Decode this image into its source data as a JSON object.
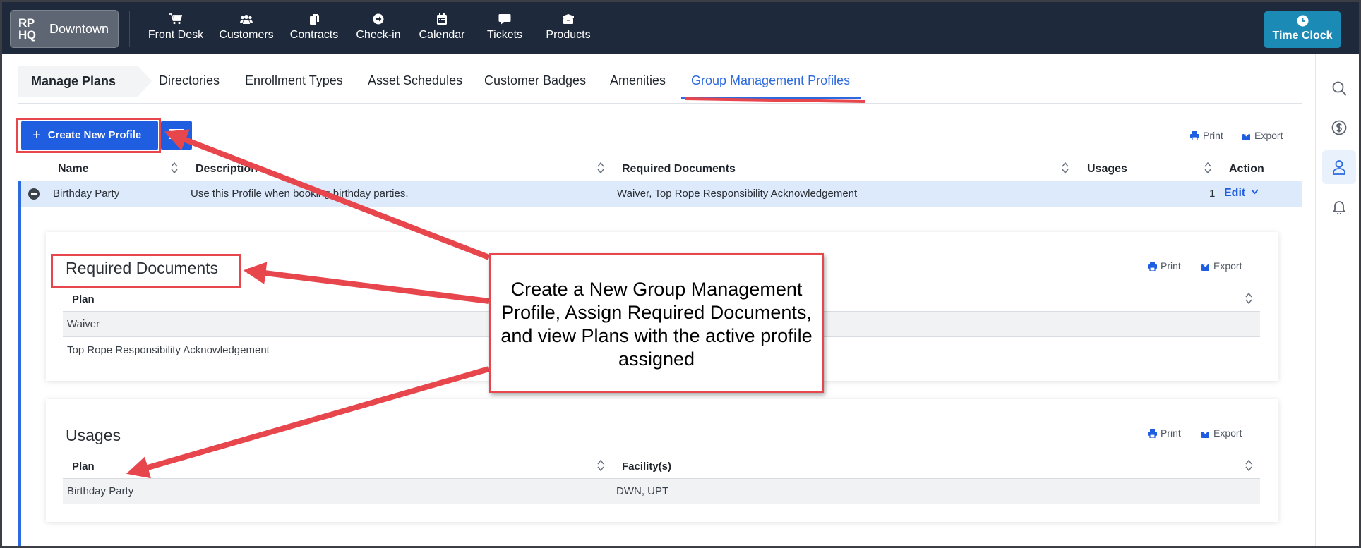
{
  "topbar": {
    "logo_mark_line1": "RP",
    "logo_mark_line2": "HQ",
    "location": "Downtown",
    "nav": [
      {
        "label": "Front Desk",
        "icon": "cart-icon"
      },
      {
        "label": "Customers",
        "icon": "users-icon"
      },
      {
        "label": "Contracts",
        "icon": "documents-icon"
      },
      {
        "label": "Check-in",
        "icon": "arrow-circle-icon"
      },
      {
        "label": "Calendar",
        "icon": "calendar-icon"
      },
      {
        "label": "Tickets",
        "icon": "chat-icon"
      },
      {
        "label": "Products",
        "icon": "box-icon"
      }
    ],
    "time_clock_label": "Time Clock"
  },
  "right_rail": [
    "search-icon",
    "dollar-icon",
    "user-icon",
    "bell-icon"
  ],
  "subtabs": {
    "section": "Manage Plans",
    "tabs": [
      "Directories",
      "Enrollment Types",
      "Asset Schedules",
      "Customer Badges",
      "Amenities",
      "Group Management Profiles"
    ],
    "active_tab": "Group Management Profiles"
  },
  "toolbar": {
    "create_label": "Create New Profile",
    "print_label": "Print",
    "export_label": "Export"
  },
  "table": {
    "headers": [
      "Name",
      "Description",
      "Required Documents",
      "Usages",
      "Action"
    ],
    "row": {
      "name": "Birthday Party",
      "description": "Use this Profile when booking birthday parties.",
      "required_documents": "Waiver, Top Rope Responsibility Acknowledgement",
      "usages": "1",
      "action": "Edit"
    }
  },
  "required_documents_panel": {
    "title": "Required Documents",
    "print_label": "Print",
    "export_label": "Export",
    "header": "Plan",
    "rows": [
      "Waiver",
      "Top Rope Responsibility Acknowledgement"
    ]
  },
  "usages_panel": {
    "title": "Usages",
    "print_label": "Print",
    "export_label": "Export",
    "headers": [
      "Plan",
      "Facility(s)"
    ],
    "rows": [
      {
        "plan": "Birthday Party",
        "facilities": "DWN, UPT"
      }
    ]
  },
  "annotation": {
    "callout_text": "Create a New Group Management Profile, Assign Required Documents, and view Plans with the active profile assigned"
  },
  "colors": {
    "nav_bg": "#1e2a3b",
    "accent": "#1f5ee0",
    "time_clock": "#1b8bb6",
    "annotation_red": "#e7464d",
    "selected_row": "#ddeafb"
  }
}
